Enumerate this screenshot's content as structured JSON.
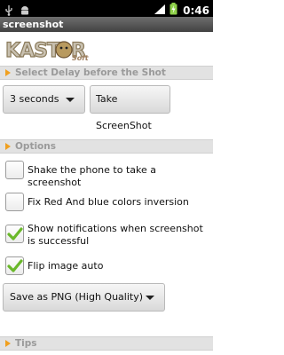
{
  "statusbar": {
    "time": "0:46",
    "icons": [
      "usb-icon",
      "android-debug-icon",
      "mobile-signal-icon",
      "battery-charging-icon"
    ]
  },
  "app": {
    "title": "screenshot"
  },
  "logo": {
    "brand": "KASTOR",
    "sub": "Soft"
  },
  "delay_section": {
    "title": "Select Delay before the Shot",
    "delay_value": "3 seconds",
    "take_button": "Take ScreenShot"
  },
  "options_section": {
    "title": "Options",
    "items": [
      {
        "label": "Shake the phone to take a screenshot",
        "checked": false
      },
      {
        "label": "Fix Red And blue colors inversion",
        "checked": false
      },
      {
        "label": "Show notifications when screenshot is successful",
        "checked": true
      },
      {
        "label": "Flip image auto",
        "checked": true
      }
    ],
    "format_value": "Save as PNG (High Quality)"
  },
  "tips_section": {
    "title": "Tips"
  },
  "colors": {
    "accent_arrow": "#f0a020",
    "check_green": "#6ab82a",
    "header_bg": "#e2e2e2"
  }
}
